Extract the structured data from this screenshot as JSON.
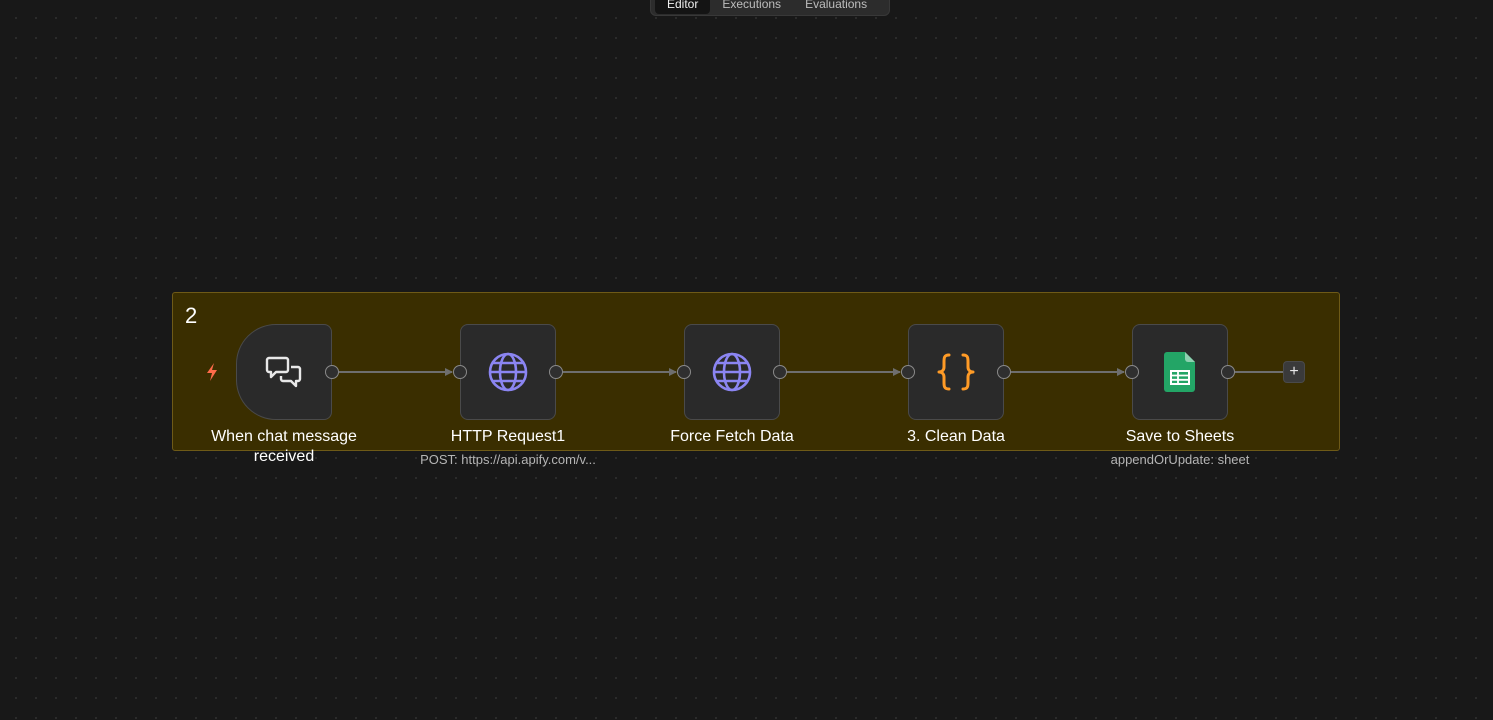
{
  "tabs": [
    {
      "label": "Editor",
      "active": true
    },
    {
      "label": "Executions",
      "active": false
    },
    {
      "label": "Evaluations",
      "active": false
    }
  ],
  "group": {
    "title": "2",
    "background": "#3a2e00",
    "border": "#6e5a17"
  },
  "nodes": [
    {
      "label": "When chat message received",
      "subtitle": "",
      "icon": "chat-bubbles-icon"
    },
    {
      "label": "HTTP Request1",
      "subtitle": "POST: https://api.apify.com/v...",
      "icon": "globe-icon"
    },
    {
      "label": "Force Fetch Data",
      "subtitle": "",
      "icon": "globe-icon"
    },
    {
      "label": "3. Clean Data",
      "subtitle": "",
      "icon": "code-braces-icon"
    },
    {
      "label": "Save to Sheets",
      "subtitle": "appendOrUpdate: sheet",
      "icon": "google-sheets-icon"
    }
  ],
  "add_node": {
    "label": "+"
  },
  "colors": {
    "accent_globe": "#8b85f2",
    "accent_code": "#ff9b26",
    "accent_sheets": "#23a566",
    "trigger_bolt": "#ff6b4a"
  }
}
